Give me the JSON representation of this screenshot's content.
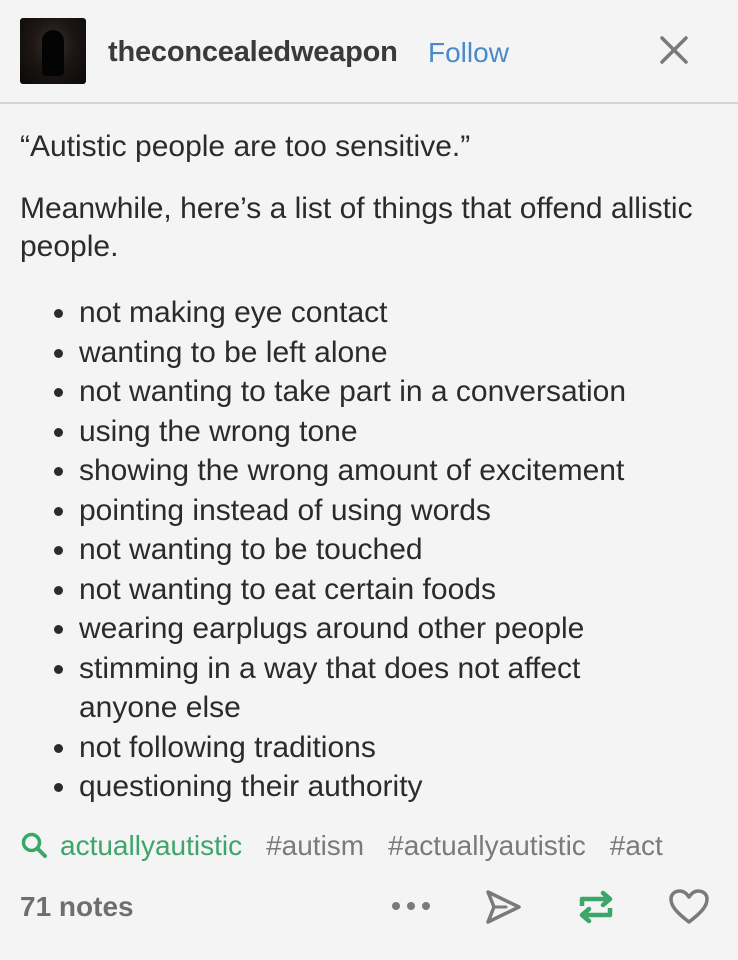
{
  "post": {
    "username": "theconcealedweapon",
    "follow_label": "Follow",
    "paragraph1": "“Autistic people are too sensitive.”",
    "paragraph2": "Meanwhile, here’s a list of things that offend allistic people.",
    "list": [
      "not making eye contact",
      "wanting to be left alone",
      "not wanting to take part in a conversation",
      "using the wrong tone",
      "showing the wrong amount of excitement",
      "pointing instead of using words",
      "not wanting to be touched",
      "not wanting to eat certain foods",
      "wearing earplugs around other people",
      "stimming in a way that does not affect anyone else",
      "not following traditions",
      "questioning their authority"
    ],
    "tags": [
      "actuallyautistic",
      "#autism",
      "#actuallyautistic",
      "#act"
    ],
    "notes": "71 notes"
  },
  "icons": {
    "close": "close-icon",
    "search": "search-icon",
    "more": "more-icon",
    "share": "share-icon",
    "reblog": "reblog-icon",
    "like": "heart-icon"
  },
  "colors": {
    "follow": "#4a8ac8",
    "featured_tag": "#3ca66a",
    "reblog": "#3ca66a",
    "tag": "#7a7a7a",
    "background": "#f4f4f4"
  }
}
